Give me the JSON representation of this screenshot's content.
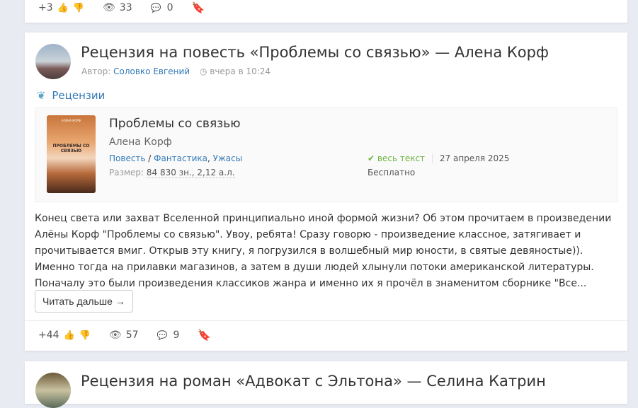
{
  "prev_post": {
    "rating": "+3",
    "views": "33",
    "comments": "0"
  },
  "post": {
    "title": "Рецензия на повесть «Проблемы со связью» — Алена Корф",
    "author_label": "Автор:",
    "author": "Соловко Евгений",
    "time": "вчера в 10:24",
    "category": "Рецензии",
    "book": {
      "cover_author": "АЛЕНА КОРФ",
      "cover_title": "ПРОБЛЕМЫ СО СВЯЗЬЮ",
      "title": "Проблемы со связью",
      "author": "Алена Корф",
      "type": "Повесть",
      "genres": [
        "Фантастика",
        "Ужасы"
      ],
      "size_label": "Размер:",
      "size": "84 830 зн., 2,12 а.л.",
      "status": "весь текст",
      "date": "27 апреля 2025",
      "price": "Бесплатно"
    },
    "text": "Конец света или захват Вселенной принципиально иной формой жизни? Об этом прочитаем в произведении Алёны Корф \"Проблемы со связью\". Увоу, ребята! Сразу говорю - произведение классное, затягивает и прочитывается вмиг. Открыв эту книгу, я погрузился в волшебный мир юности, в святые девяностые)). Именно тогда на прилавки магазинов, а затем в души людей хлынули потоки американской литературы. Поначалу это были произведения классиков жанра и именно их я прочёл в знаменитом сборнике \"Все...",
    "read_more": "Читать дальше →",
    "rating": "+44",
    "views": "57",
    "comments": "9"
  },
  "next_post": {
    "title": "Рецензия на роман «Адвокат с Эльтона» — Селина Катрин"
  }
}
